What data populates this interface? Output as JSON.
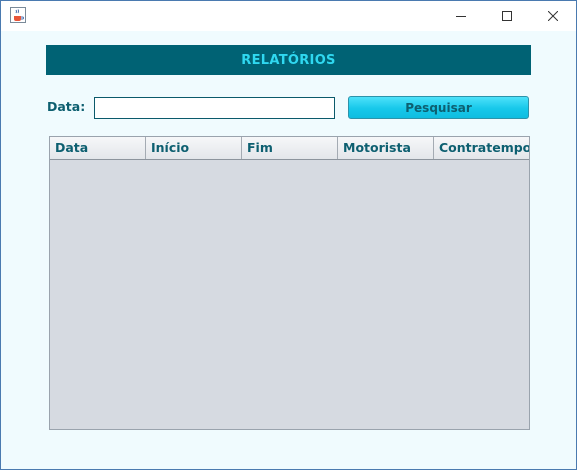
{
  "window": {
    "icon": "java-cup-icon",
    "controls": [
      "minimize-icon",
      "maximize-icon",
      "close-icon"
    ]
  },
  "header": {
    "title": "RELATÓRIOS"
  },
  "filter": {
    "date_label": "Data:",
    "date_value": "",
    "search_label": "Pesquisar"
  },
  "table": {
    "columns": [
      "Data",
      "Início",
      "Fim",
      "Motorista",
      "Contratempo"
    ],
    "rows": []
  },
  "colors": {
    "banner": "#006274",
    "banner_text": "#2fd8f0",
    "label_text": "#0d5f70",
    "button": "#17c8ea",
    "background": "#f0fbfe",
    "table_body": "#d6dae1"
  }
}
